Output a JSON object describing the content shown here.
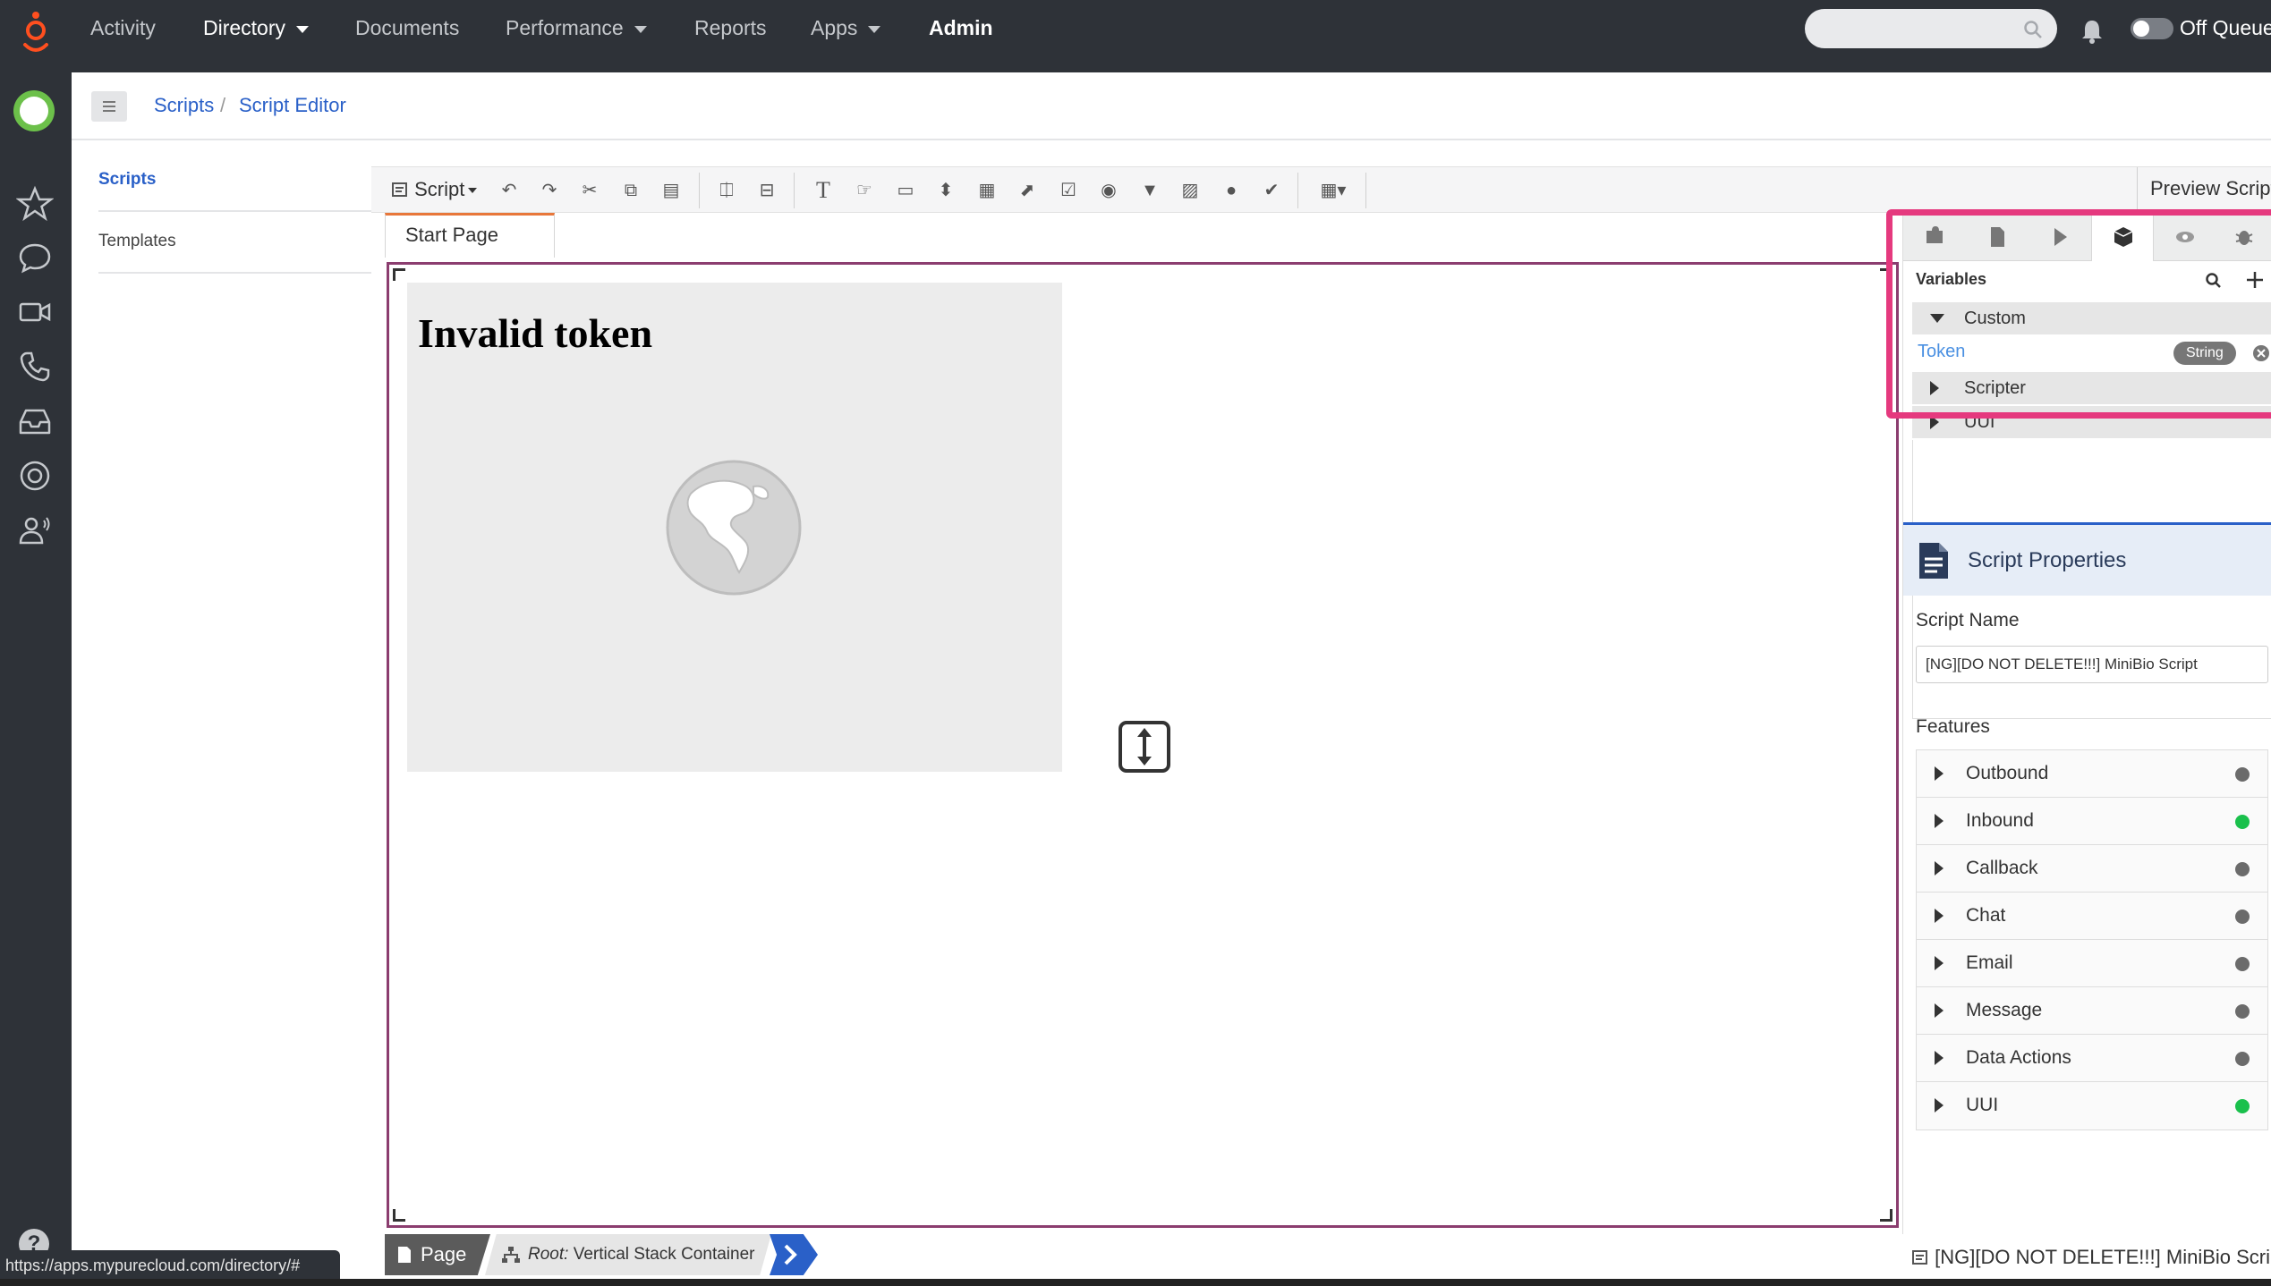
{
  "topnav": {
    "items": [
      "Activity",
      "Directory",
      "Documents",
      "Performance",
      "Reports",
      "Apps",
      "Admin"
    ],
    "status_label": "Off Queue"
  },
  "breadcrumb": [
    "Scripts",
    "Script Editor"
  ],
  "leftnav": {
    "scripts": "Scripts",
    "templates": "Templates"
  },
  "toolbar": {
    "script_menu": "Script",
    "preview": "Preview Script"
  },
  "tabs": [
    "Start Page"
  ],
  "canvas": {
    "image_caption": "Invalid token"
  },
  "bottombar": {
    "page": "Page",
    "root_prefix": "Root:",
    "root_value": "Vertical Stack Container",
    "script_ref": "[NG][DO NOT DELETE!!!] MiniBio Script"
  },
  "variables": {
    "heading": "Variables",
    "groups": [
      "Custom",
      "Scripter",
      "UUI"
    ],
    "custom_var": {
      "name": "Token",
      "type": "String"
    }
  },
  "properties": {
    "title": "Script Properties",
    "name_label": "Script Name",
    "name_value": "[NG][DO NOT DELETE!!!] MiniBio Script",
    "features_label": "Features",
    "features": [
      {
        "name": "Outbound",
        "enabled": false
      },
      {
        "name": "Inbound",
        "enabled": true
      },
      {
        "name": "Callback",
        "enabled": false
      },
      {
        "name": "Chat",
        "enabled": false
      },
      {
        "name": "Email",
        "enabled": false
      },
      {
        "name": "Message",
        "enabled": false
      },
      {
        "name": "Data Actions",
        "enabled": false
      },
      {
        "name": "UUI",
        "enabled": true
      }
    ]
  },
  "status_url": "https://apps.mypurecloud.com/directory/#",
  "colors": {
    "accent": "#2a60c8",
    "highlight": "#e5397e",
    "tab_active": "#e8773a",
    "enabled": "#1ac04c"
  }
}
